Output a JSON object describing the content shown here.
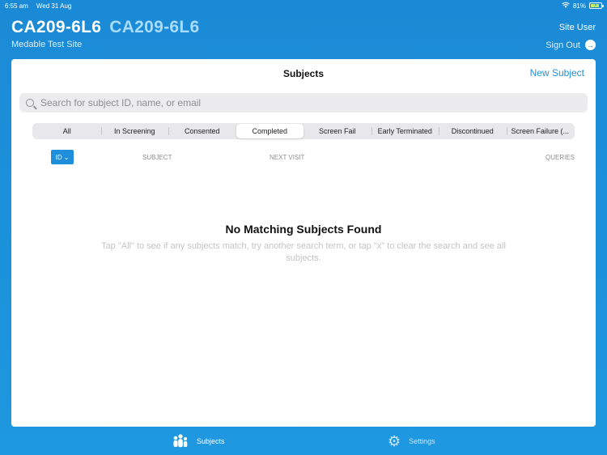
{
  "status_bar": {
    "time": "6:55 am",
    "date": "Wed 31 Aug",
    "battery": "81%"
  },
  "header": {
    "study_code": "CA209-6L6",
    "study_code_secondary": "CA209-6L6",
    "site_name": "Medable Test Site",
    "user_label": "Site User",
    "sign_out_label": "Sign Out"
  },
  "panel": {
    "title": "Subjects",
    "new_subject_label": "New Subject",
    "search_placeholder": "Search for subject ID, name, or email",
    "segments": [
      "All",
      "In Screening",
      "Consented",
      "Completed",
      "Screen Fail",
      "Early Terminated",
      "Discontinued",
      "Screen Failure (..."
    ],
    "active_segment": "Completed",
    "columns": {
      "id": "ID",
      "subject": "SUBJECT",
      "next_visit": "NEXT VISIT",
      "queries": "QUERIES"
    },
    "empty_title": "No Matching Subjects Found",
    "empty_text": "Tap \"All\" to see if any subjects match, try another search term, or tap \"x\" to clear the search and see all subjects."
  },
  "tab_bar": {
    "tabs": [
      {
        "label": "Subjects",
        "icon": "people-icon",
        "active": true
      },
      {
        "label": "Settings",
        "icon": "gear-icon",
        "active": false
      }
    ]
  }
}
